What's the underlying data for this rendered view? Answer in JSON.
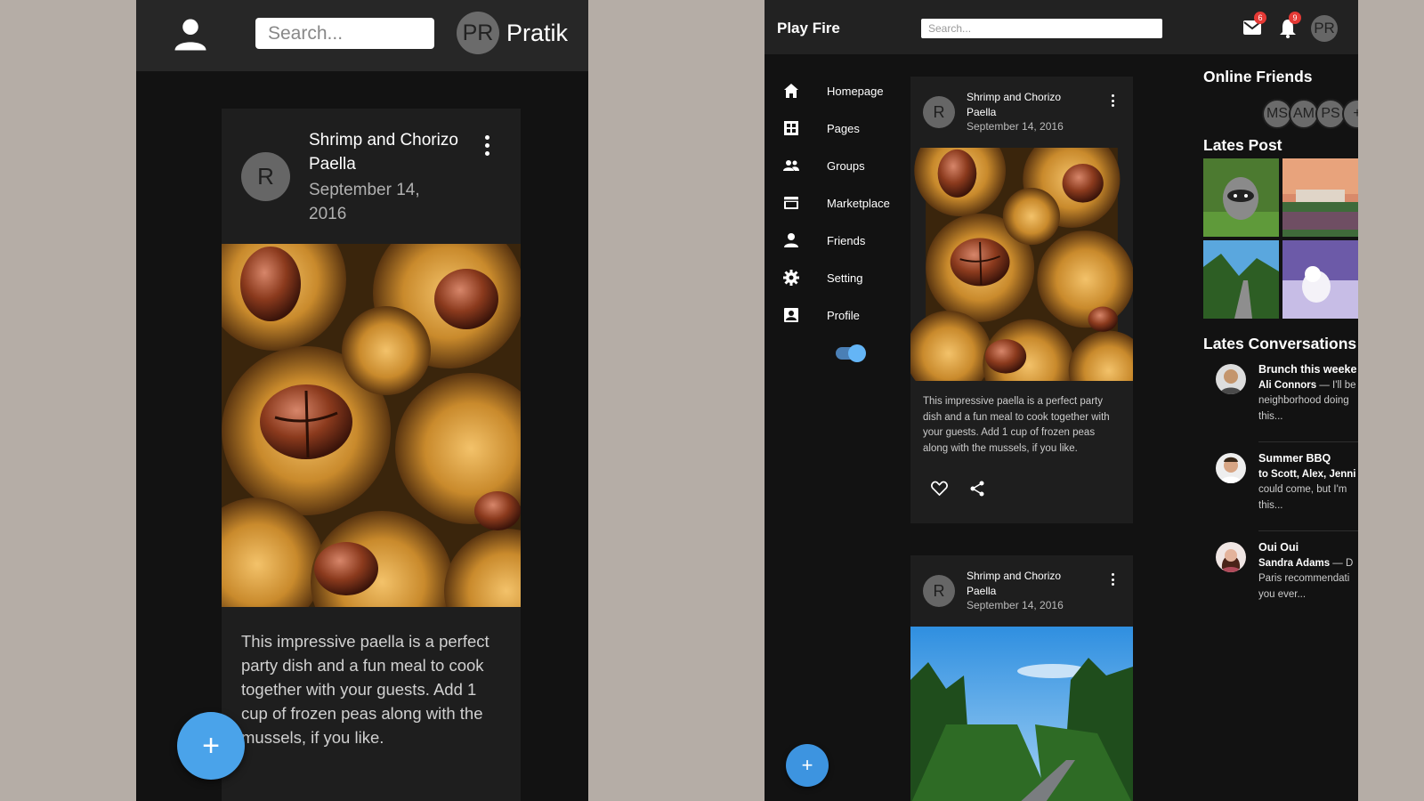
{
  "mobile": {
    "search_placeholder": "Search...",
    "user": {
      "initials": "PR",
      "name": "Pratik"
    },
    "post": {
      "avatar_letter": "R",
      "title": "Shrimp and Chorizo Paella",
      "date": "September 14, 2016",
      "body": "This impressive paella is a perfect party dish and a fun meal to cook together with your guests. Add 1 cup of frozen peas along with the mussels, if you like."
    },
    "fab_label": "+"
  },
  "desktop": {
    "brand": "Play Fire",
    "search_placeholder": "Search...",
    "mail_count": "6",
    "notif_count": "9",
    "avatar_initials": "PR",
    "nav": [
      {
        "label": "Homepage",
        "icon": "home-icon"
      },
      {
        "label": "Pages",
        "icon": "pages-icon"
      },
      {
        "label": "Groups",
        "icon": "groups-icon"
      },
      {
        "label": "Marketplace",
        "icon": "store-icon"
      },
      {
        "label": "Friends",
        "icon": "person-icon"
      },
      {
        "label": "Setting",
        "icon": "gear-icon"
      },
      {
        "label": "Profile",
        "icon": "profile-icon"
      }
    ],
    "dark_mode": true,
    "fab_label": "+",
    "posts": [
      {
        "avatar_letter": "R",
        "title": "Shrimp and Chorizo Paella",
        "date": "September 14, 2016",
        "body": "This impressive paella is a perfect party dish and a fun meal to cook together with your guests. Add 1 cup of frozen peas along with the mussels, if you like."
      },
      {
        "avatar_letter": "R",
        "title": "Shrimp and Chorizo Paella",
        "date": "September 14, 2016"
      }
    ],
    "sidebar": {
      "online_title": "Online Friends",
      "online": [
        "MS",
        "AM",
        "PS",
        "+"
      ],
      "latest_title": "Lates Post",
      "conversations_title": "Lates Conversations",
      "conversations": [
        {
          "subject": "Brunch this weeke",
          "name": "Ali Connors",
          "line1": " — I'll be",
          "line2": "neighborhood doing",
          "line3": "this..."
        },
        {
          "subject": "Summer BBQ",
          "name": "to Scott, Alex, Jenni",
          "line1": "",
          "line2": "could come, but I'm",
          "line3": "this..."
        },
        {
          "subject": "Oui Oui",
          "name": "Sandra Adams",
          "line1": " — D",
          "line2": "Paris recommendati",
          "line3": "you ever..."
        }
      ]
    }
  },
  "colors": {
    "accent": "#4aa3ea",
    "background": "#121212",
    "card": "#1e1e1e",
    "badge": "#e53935"
  }
}
